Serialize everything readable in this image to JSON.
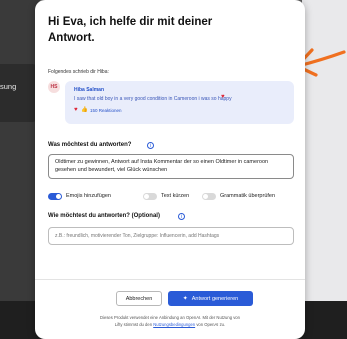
{
  "background": {
    "side_label": "sung"
  },
  "modal": {
    "title": "Hi Eva, ich helfe dir mit deiner Antwort.",
    "quote_label": "Folgendes schrieb dir Hiba:",
    "message": {
      "avatar_initials": "HS",
      "author": "Hiba Salman",
      "text": "I saw that old boy in a very good condition in Cameroon i was so happy",
      "reactions": "150 Reaktionen"
    },
    "answer_question": "Was möchtest du antworten?",
    "answer_text": "Oldtimer zu gewinnen, Antwort auf Insta Kommentar der so einen Oldtimer in cameroon gesehen und bewundert, viel Glück wünschen",
    "toggles": [
      {
        "label": "Emojis hinzufügen",
        "on": true
      },
      {
        "label": "Text kürzen",
        "on": false
      },
      {
        "label": "Grammatik überprüfen",
        "on": false
      }
    ],
    "how_question": "Wie möchtest du antworten? (Optional)",
    "how_placeholder": "z.B.: freundlich, motivierender Ton, Zielgruppe: Influencerin, add Hashtags",
    "cancel_label": "Abbrechen",
    "generate_label": "Antwort generieren",
    "footer_line1": "Dieses Produkt verwendet eine Anbindung an OpenAI. Mit der Nutzung von",
    "footer_line2_prefix": "Lifty stimmst du den",
    "footer_link": "Nutzungsbedingungen",
    "footer_line2_suffix": "von OpenAI zu."
  },
  "colors": {
    "accent": "#2a5bd7",
    "annotation_arrow": "#f07020",
    "message_bg": "#e9edfb"
  }
}
